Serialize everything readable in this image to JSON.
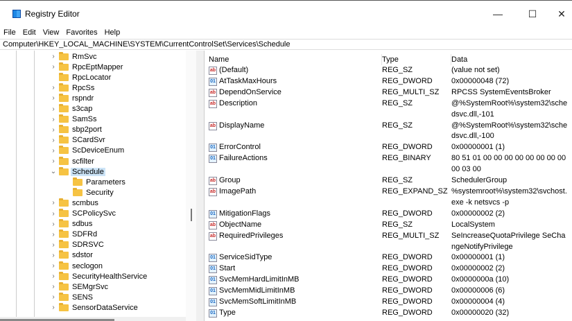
{
  "window": {
    "title": "Registry Editor",
    "minimize": "—",
    "maximize": "☐",
    "close": "✕"
  },
  "menu": [
    "File",
    "Edit",
    "View",
    "Favorites",
    "Help"
  ],
  "address": "Computer\\HKEY_LOCAL_MACHINE\\SYSTEM\\CurrentControlSet\\Services\\Schedule",
  "tree": [
    {
      "label": "RmSvc",
      "expander": "›",
      "level": 0
    },
    {
      "label": "RpcEptMapper",
      "expander": "›",
      "level": 0
    },
    {
      "label": "RpcLocator",
      "expander": "",
      "level": 0
    },
    {
      "label": "RpcSs",
      "expander": "›",
      "level": 0
    },
    {
      "label": "rspndr",
      "expander": "›",
      "level": 0
    },
    {
      "label": "s3cap",
      "expander": "›",
      "level": 0
    },
    {
      "label": "SamSs",
      "expander": "›",
      "level": 0
    },
    {
      "label": "sbp2port",
      "expander": "›",
      "level": 0
    },
    {
      "label": "SCardSvr",
      "expander": "›",
      "level": 0
    },
    {
      "label": "ScDeviceEnum",
      "expander": "›",
      "level": 0
    },
    {
      "label": "scfilter",
      "expander": "›",
      "level": 0
    },
    {
      "label": "Schedule",
      "expander": "⌄",
      "level": 0,
      "selected": true
    },
    {
      "label": "Parameters",
      "expander": "",
      "level": 1
    },
    {
      "label": "Security",
      "expander": "",
      "level": 1
    },
    {
      "label": "scmbus",
      "expander": "›",
      "level": 0
    },
    {
      "label": "SCPolicySvc",
      "expander": "›",
      "level": 0
    },
    {
      "label": "sdbus",
      "expander": "›",
      "level": 0
    },
    {
      "label": "SDFRd",
      "expander": "›",
      "level": 0
    },
    {
      "label": "SDRSVC",
      "expander": "›",
      "level": 0
    },
    {
      "label": "sdstor",
      "expander": "›",
      "level": 0
    },
    {
      "label": "seclogon",
      "expander": "›",
      "level": 0
    },
    {
      "label": "SecurityHealthService",
      "expander": "›",
      "level": 0
    },
    {
      "label": "SEMgrSvc",
      "expander": "›",
      "level": 0
    },
    {
      "label": "SENS",
      "expander": "›",
      "level": 0
    },
    {
      "label": "SensorDataService",
      "expander": "›",
      "level": 0
    }
  ],
  "columns": {
    "name": "Name",
    "type": "Type",
    "data": "Data"
  },
  "values": [
    {
      "icon": "string-value-icon",
      "glyph": "ab",
      "name": "(Default)",
      "type": "REG_SZ",
      "data": "(value not set)"
    },
    {
      "icon": "binary-value-icon",
      "glyph": "01",
      "name": "AtTaskMaxHours",
      "type": "REG_DWORD",
      "data": "0x00000048 (72)"
    },
    {
      "icon": "string-value-icon",
      "glyph": "ab",
      "name": "DependOnService",
      "type": "REG_MULTI_SZ",
      "data": "RPCSS SystemEventsBroker"
    },
    {
      "icon": "string-value-icon",
      "glyph": "ab",
      "name": "Description",
      "type": "REG_SZ",
      "data": "@%SystemRoot%\\system32\\schedsvc.dll,-101"
    },
    {
      "icon": "string-value-icon",
      "glyph": "ab",
      "name": "DisplayName",
      "type": "REG_SZ",
      "data": "@%SystemRoot%\\system32\\schedsvc.dll,-100"
    },
    {
      "icon": "binary-value-icon",
      "glyph": "01",
      "name": "ErrorControl",
      "type": "REG_DWORD",
      "data": "0x00000001 (1)"
    },
    {
      "icon": "binary-value-icon",
      "glyph": "01",
      "name": "FailureActions",
      "type": "REG_BINARY",
      "data": "80 51 01 00 00 00 00 00 00 00 00 00 03 00"
    },
    {
      "icon": "string-value-icon",
      "glyph": "ab",
      "name": "Group",
      "type": "REG_SZ",
      "data": "SchedulerGroup"
    },
    {
      "icon": "string-value-icon",
      "glyph": "ab",
      "name": "ImagePath",
      "type": "REG_EXPAND_SZ",
      "data": "%systemroot%\\system32\\svchost.exe -k netsvcs -p"
    },
    {
      "icon": "binary-value-icon",
      "glyph": "01",
      "name": "MitigationFlags",
      "type": "REG_DWORD",
      "data": "0x00000002 (2)"
    },
    {
      "icon": "string-value-icon",
      "glyph": "ab",
      "name": "ObjectName",
      "type": "REG_SZ",
      "data": "LocalSystem"
    },
    {
      "icon": "string-value-icon",
      "glyph": "ab",
      "name": "RequiredPrivileges",
      "type": "REG_MULTI_SZ",
      "data": "SeIncreaseQuotaPrivilege SeChangeNotifyPrivilege"
    },
    {
      "icon": "binary-value-icon",
      "glyph": "01",
      "name": "ServiceSidType",
      "type": "REG_DWORD",
      "data": "0x00000001 (1)"
    },
    {
      "icon": "binary-value-icon",
      "glyph": "01",
      "name": "Start",
      "type": "REG_DWORD",
      "data": "0x00000002 (2)"
    },
    {
      "icon": "binary-value-icon",
      "glyph": "01",
      "name": "SvcMemHardLimitInMB",
      "type": "REG_DWORD",
      "data": "0x0000000a (10)"
    },
    {
      "icon": "binary-value-icon",
      "glyph": "01",
      "name": "SvcMemMidLimitInMB",
      "type": "REG_DWORD",
      "data": "0x00000006 (6)"
    },
    {
      "icon": "binary-value-icon",
      "glyph": "01",
      "name": "SvcMemSoftLimitInMB",
      "type": "REG_DWORD",
      "data": "0x00000004 (4)"
    },
    {
      "icon": "binary-value-icon",
      "glyph": "01",
      "name": "Type",
      "type": "REG_DWORD",
      "data": "0x00000020 (32)"
    }
  ]
}
